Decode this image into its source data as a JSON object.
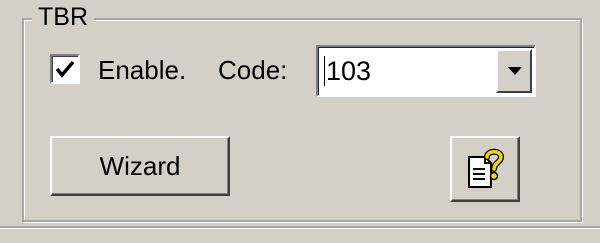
{
  "group": {
    "title": "TBR"
  },
  "enable": {
    "label": "Enable.",
    "checked": true
  },
  "code": {
    "label": "Code:",
    "value": "103"
  },
  "buttons": {
    "wizard": "Wizard",
    "help_icon": "help-document-icon"
  },
  "colors": {
    "face": "#d4d0c8",
    "shadow": "#808080",
    "highlight": "#ffffff",
    "help_yellow": "#f2d900"
  }
}
